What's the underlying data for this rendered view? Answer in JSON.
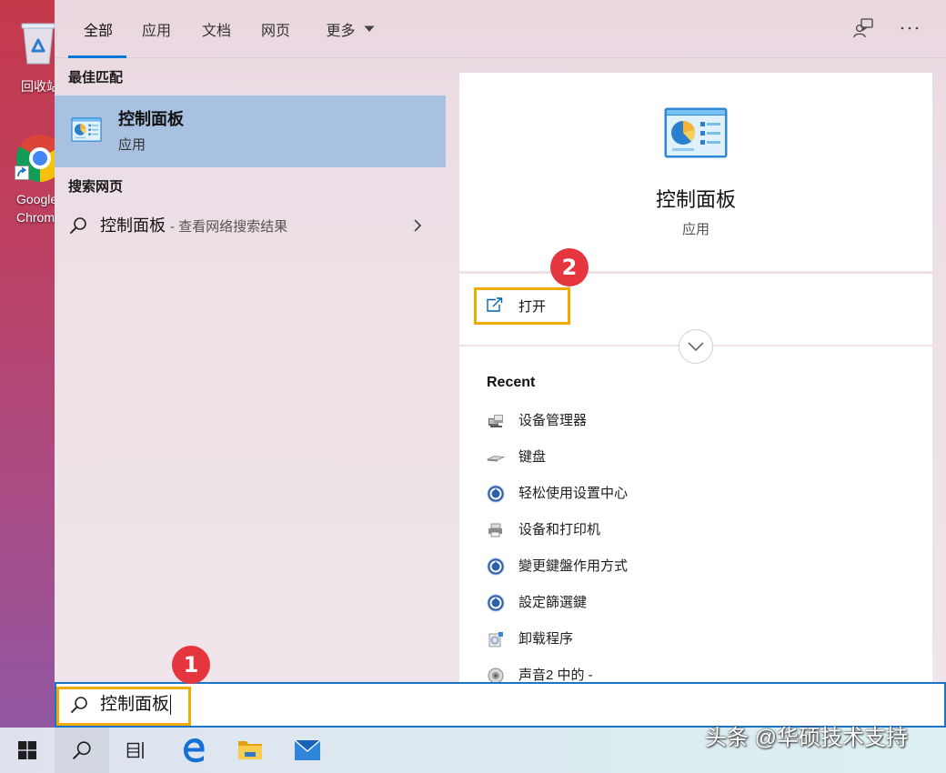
{
  "desktop": {
    "recycle_bin": {
      "label": "回收站",
      "icon": "recycle-bin-icon"
    },
    "chrome": {
      "label_line1": "Google",
      "label_line2": "Chrome",
      "icon": "chrome-icon"
    }
  },
  "tabs": [
    {
      "label": "全部",
      "active": true
    },
    {
      "label": "应用",
      "active": false
    },
    {
      "label": "文档",
      "active": false
    },
    {
      "label": "网页",
      "active": false
    },
    {
      "label": "更多",
      "active": false,
      "icon": "caret-down-icon"
    }
  ],
  "header_actions": {
    "feedback_icon": "feedback-icon",
    "more_icon": "more-options-icon"
  },
  "results": {
    "best_match_heading": "最佳匹配",
    "best_match": {
      "title": "控制面板",
      "subtitle": "应用",
      "icon": "control-panel-icon"
    },
    "web_heading": "搜索网页",
    "web_result": {
      "query": "控制面板",
      "suffix": "- 查看网络搜索结果",
      "icon": "search-icon",
      "chevron": "chevron-right-icon"
    }
  },
  "detail": {
    "icon": "control-panel-icon",
    "title": "控制面板",
    "subtitle": "应用",
    "open_label": "打开",
    "open_icon": "open-icon",
    "expand_icon": "chevron-down-icon",
    "recent_heading": "Recent",
    "recent": [
      {
        "label": "设备管理器",
        "icon": "device-manager-icon"
      },
      {
        "label": "键盘",
        "icon": "keyboard-icon"
      },
      {
        "label": "轻松使用设置中心",
        "icon": "ease-of-access-icon"
      },
      {
        "label": "设备和打印机",
        "icon": "devices-printers-icon"
      },
      {
        "label": "變更鍵盤作用方式",
        "icon": "ease-of-access-icon"
      },
      {
        "label": "設定篩選鍵",
        "icon": "ease-of-access-icon"
      },
      {
        "label": "卸载程序",
        "icon": "programs-icon"
      },
      {
        "label": "声音2 中的 -",
        "icon": "sound-icon"
      }
    ]
  },
  "search_box": {
    "value": "控制面板",
    "icon": "search-icon"
  },
  "annotations": {
    "step1": "1",
    "step2": "2"
  },
  "taskbar": {
    "icons": [
      "windows-start-icon",
      "search-icon",
      "task-view-icon",
      "edge-icon",
      "file-explorer-icon",
      "mail-icon"
    ]
  },
  "watermark": "头条 @华硕技术支持",
  "colors": {
    "accent": "#0078d7",
    "selection": "#a9c1e1",
    "highlight_box": "#f2a900",
    "badge": "#e5353e",
    "search_border": "#1b74c5"
  }
}
